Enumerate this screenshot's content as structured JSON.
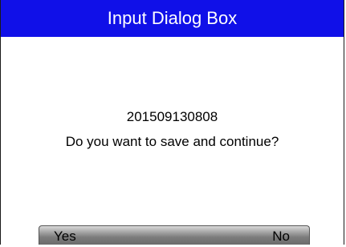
{
  "dialog": {
    "title": "Input Dialog Box",
    "value": "201509130808",
    "message": "Do you want to save and continue?"
  },
  "buttons": {
    "yes_label": "Yes",
    "no_label": "No"
  },
  "colors": {
    "title_bar": "#1010e8",
    "title_text": "#ffffff",
    "background": "#ffffff",
    "button_bar": "#8c8c8c"
  }
}
